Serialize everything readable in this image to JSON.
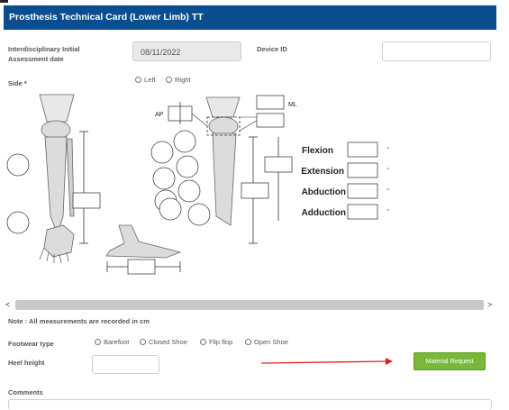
{
  "header": {
    "title": "Prosthesis Technical Card (Lower Limb) TT"
  },
  "assessment": {
    "label_line1": "Interdisciplinary Initial",
    "label_line2": "Assessment date",
    "value": "08/11/2022"
  },
  "device": {
    "label": "Device ID",
    "value": ""
  },
  "side": {
    "label": "Side *",
    "options": [
      "Left",
      "Right"
    ]
  },
  "diagram": {
    "ap_label": "AP",
    "ml_label": "ML",
    "angles": [
      {
        "label": "Flexion",
        "unit": "°"
      },
      {
        "label": "Extension",
        "unit": "°"
      },
      {
        "label": "Abduction",
        "unit": "°"
      },
      {
        "label": "Adduction",
        "unit": "°"
      }
    ]
  },
  "scroll": {
    "left_arrow": "<",
    "right_arrow": ">"
  },
  "note": "Note : All measurements are recorded in cm",
  "footwear": {
    "label": "Footwear type",
    "options": [
      "Barefoot",
      "Closed Shoe",
      "Flip flop",
      "Open Shoe"
    ]
  },
  "heel": {
    "label": "Heel height",
    "value": ""
  },
  "material_button": {
    "label": "Material Request"
  },
  "comments": {
    "label": "Comments"
  },
  "colors": {
    "header_bg": "#0a4e8f",
    "button_bg": "#7ab83a",
    "arrow": "#e02020"
  }
}
